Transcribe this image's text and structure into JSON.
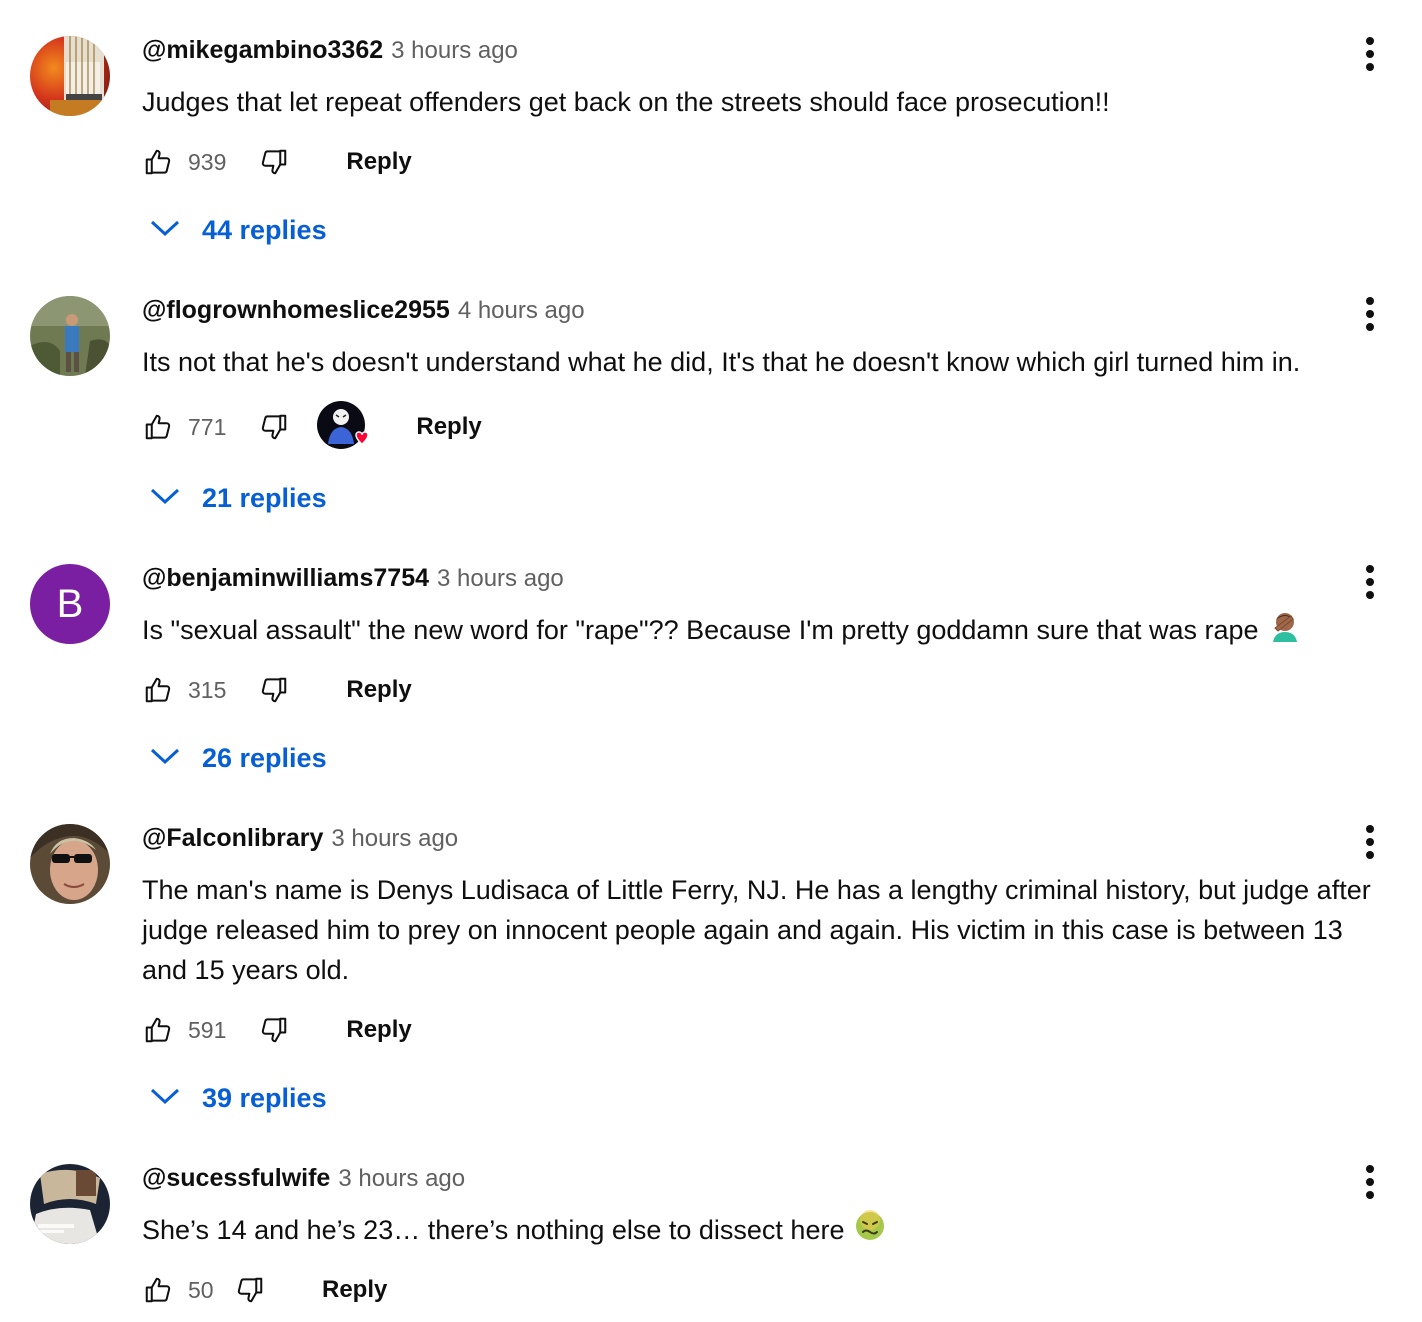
{
  "comments": [
    {
      "author": "@mikegambino3362",
      "time": "3 hours ago",
      "text": "Judges that let repeat offenders get back on the streets should face prosecution!!",
      "likes": "939",
      "reply_label": "Reply",
      "replies_label": "44 replies"
    },
    {
      "author": "@flogrownhomeslice2955",
      "time": "4 hours ago",
      "text": "Its not that he's doesn't understand what he did,  It's that he doesn't know which girl turned him in.",
      "likes": "771",
      "reply_label": "Reply",
      "replies_label": "21 replies"
    },
    {
      "author": "@benjaminwilliams7754",
      "time": "3 hours ago",
      "avatar_letter": "B",
      "text": "Is \"sexual assault\" the new word for \"rape\"?? Because I'm pretty goddamn sure that was rape",
      "likes": "315",
      "reply_label": "Reply",
      "replies_label": "26 replies"
    },
    {
      "author": "@Falconlibrary",
      "time": "3 hours ago",
      "text": "The man's name is Denys Ludisaca of Little Ferry, NJ.  He has a lengthy criminal history, but judge after judge released him to prey on innocent people again and again.  His victim in this case is between 13 and 15 years old.",
      "likes": "591",
      "reply_label": "Reply",
      "replies_label": "39 replies"
    },
    {
      "author": "@sucessfulwife",
      "time": "3 hours ago",
      "text": "She’s 14 and he’s 23… there’s nothing else to dissect here",
      "likes": "50",
      "reply_label": "Reply"
    }
  ],
  "colors": {
    "link_blue": "#065fd4",
    "meta_gray": "#606060",
    "avatar_purple": "#7b1fa2",
    "heart_red": "#ff0033"
  },
  "icons": [
    "like-icon",
    "dislike-icon",
    "more-vert-icon",
    "chevron-down-icon",
    "creator-heart-icon",
    "facepalm-emoji",
    "nauseated-face-emoji"
  ]
}
